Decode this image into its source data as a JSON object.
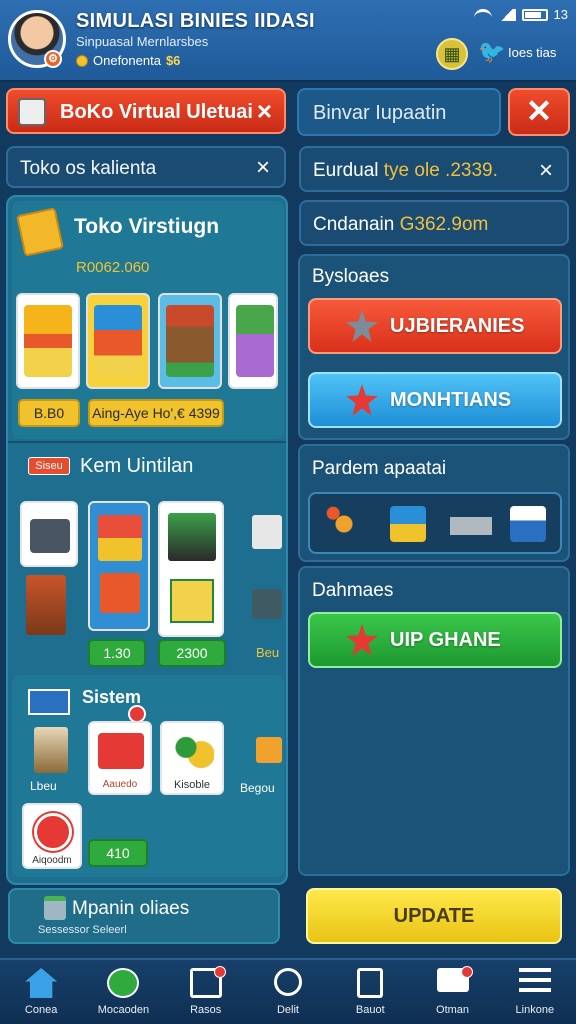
{
  "header": {
    "title": "SIMULASI BINIES IIDASI",
    "subtitle": "Sinpuasal Mernlarsbes",
    "coin_label": "Onefonenta",
    "coin_value": "$6",
    "share_label": "Ioes tias"
  },
  "status_bar": {
    "battery": "13"
  },
  "left_tab": {
    "label": "BoKo Virtual Uletuai",
    "close": "×"
  },
  "right_search": {
    "placeholder": "Binvar Iupaatin",
    "close": "✕"
  },
  "left_search": {
    "placeholder": "Toko os kalienta",
    "clear": "×"
  },
  "right_info1": {
    "label": "Eurdual ",
    "value": "tye ole .2339.",
    "clear": "×"
  },
  "right_info2": {
    "label": "Cndanain ",
    "value": "G362.9om"
  },
  "shop": {
    "title": "Toko Virstiugn",
    "price": "R0062.060",
    "pill_left": "B.B0",
    "pill_right": "Aing-Aye Ho',€ 4399",
    "kem_badge": "Siseu",
    "kem_title": "Kem Uintilan",
    "kem_pill1": "1.30",
    "kem_pill2": "2300",
    "kem_edge": "Beu",
    "sistem_title": "Sistem",
    "sistem_label1": "Lbeu",
    "sistem_label2": "Aauedo",
    "sistem_label3": "Kisoble",
    "sistem_label4": "Begou",
    "sistem_label5": "Aiqoodm",
    "sistem_pill": "410",
    "strip_title": "Mpanin oliaes",
    "strip_sub": "Sessessor Seleerl"
  },
  "right": {
    "busines_title": "Bysloaes",
    "btn_red": "UJBIERANIES",
    "btn_blue": "MONHTIANS",
    "pardem_title": "Pardem apaatai",
    "dahm_title": "Dahmaes",
    "btn_green": "UIP GHANE",
    "update": "UPDATE"
  },
  "nav": [
    {
      "label": "Conea",
      "icon": "home-icon"
    },
    {
      "label": "Mocaoden",
      "icon": "tools-icon"
    },
    {
      "label": "Rasos",
      "icon": "gift-icon"
    },
    {
      "label": "Delit",
      "icon": "search-icon"
    },
    {
      "label": "Bauot",
      "icon": "report-icon"
    },
    {
      "label": "Otman",
      "icon": "chat-icon"
    },
    {
      "label": "Linkone",
      "icon": "menu-icon"
    }
  ],
  "colors": {
    "accent_red": "#e03a20",
    "accent_yellow": "#f0c22c",
    "bg": "#123a5e"
  }
}
